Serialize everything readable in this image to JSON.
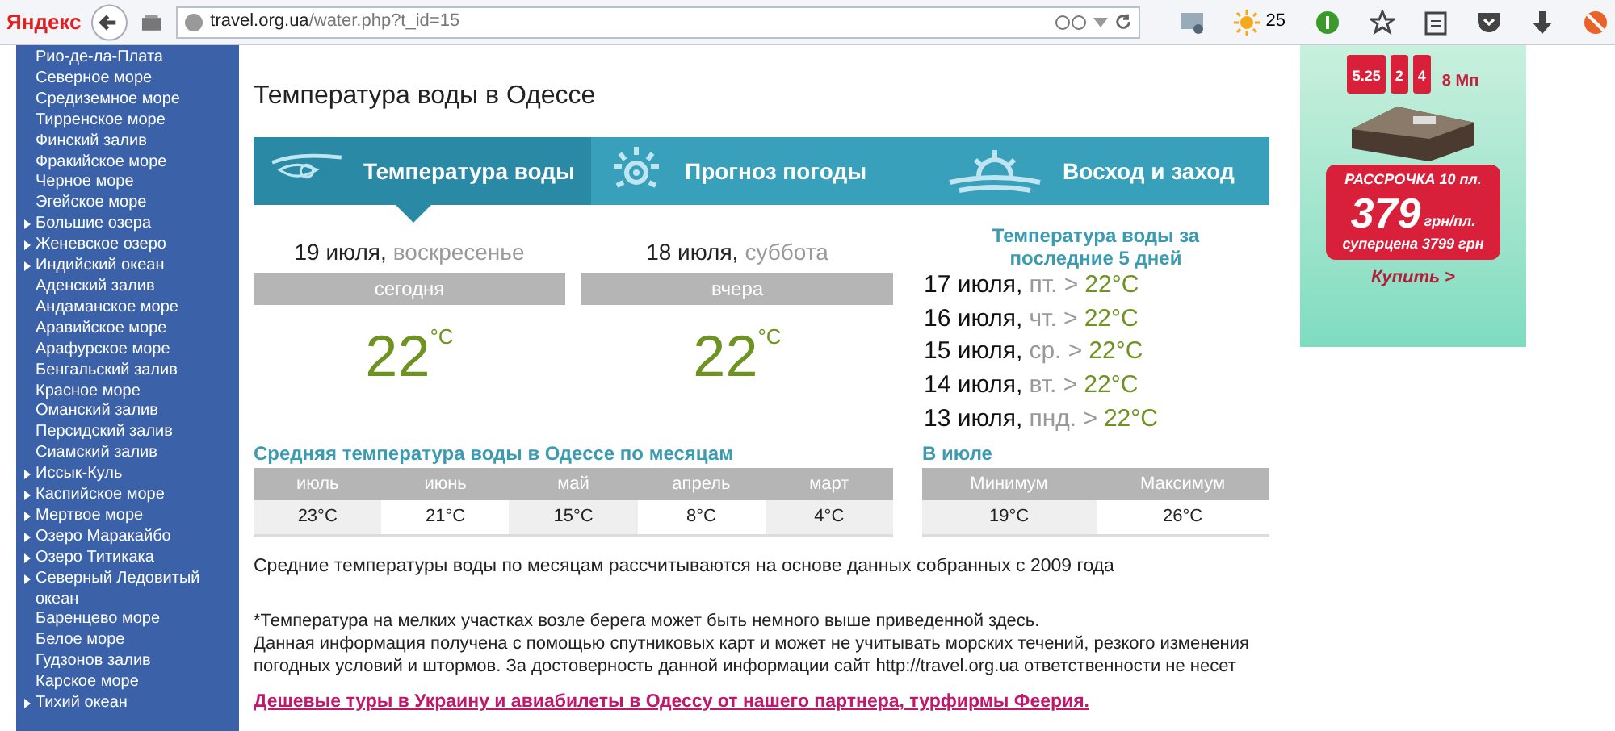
{
  "browser": {
    "logo": "Яндекс",
    "url_host": "travel.org.ua",
    "url_path": "/water.php?t_id=15",
    "weather": "25"
  },
  "sidebar": {
    "items": [
      {
        "label": "Рио-де-ла-Плата",
        "expandable": false
      },
      {
        "label": "Северное море",
        "expandable": false
      },
      {
        "label": "Средиземное море",
        "expandable": false
      },
      {
        "label": "Тирренское море",
        "expandable": false
      },
      {
        "label": "Финский залив",
        "expandable": false
      },
      {
        "label": "Фракийское море",
        "expandable": false
      },
      {
        "label": "Черное море",
        "expandable": false
      },
      {
        "label": "Эгейское море",
        "expandable": false
      },
      {
        "label": "Большие озера",
        "expandable": true
      },
      {
        "label": "Женевское озеро",
        "expandable": true
      },
      {
        "label": "Индийский океан",
        "expandable": true
      },
      {
        "label": "Аденский залив",
        "expandable": false
      },
      {
        "label": "Андаманское море",
        "expandable": false
      },
      {
        "label": "Аравийское море",
        "expandable": false
      },
      {
        "label": "Арафурское море",
        "expandable": false
      },
      {
        "label": "Бенгальский залив",
        "expandable": false
      },
      {
        "label": "Красное море",
        "expandable": false
      },
      {
        "label": "Оманский залив",
        "expandable": false
      },
      {
        "label": "Персидский залив",
        "expandable": false
      },
      {
        "label": "Сиамский залив",
        "expandable": false
      },
      {
        "label": "Иссык-Куль",
        "expandable": true
      },
      {
        "label": "Каспийское море",
        "expandable": true
      },
      {
        "label": "Мертвое море",
        "expandable": true
      },
      {
        "label": "Озеро Маракайбо",
        "expandable": true
      },
      {
        "label": "Озеро Титикака",
        "expandable": true
      },
      {
        "label": "Северный Ледовитый океан",
        "expandable": true
      },
      {
        "label": "Баренцево море",
        "expandable": false
      },
      {
        "label": "Белое море",
        "expandable": false
      },
      {
        "label": "Гудзонов залив",
        "expandable": false
      },
      {
        "label": "Карское море",
        "expandable": false
      },
      {
        "label": "Тихий океан",
        "expandable": true
      }
    ]
  },
  "title": "Температура воды в Одессе",
  "tabs": [
    {
      "label": "Температура воды",
      "kind": "water",
      "selected": true
    },
    {
      "label": "Прогноз погоды",
      "kind": "sun",
      "selected": false
    },
    {
      "label": "Восход и заход",
      "kind": "sunrise",
      "selected": false
    }
  ],
  "days": [
    {
      "date": "19 июля,",
      "weekday": "воскресенье",
      "caption": "сегодня",
      "temp": "22",
      "unit": "°C"
    },
    {
      "date": "18 июля,",
      "weekday": "суббота",
      "caption": "вчера",
      "temp": "22",
      "unit": "°C"
    }
  ],
  "last_days": {
    "title": "Температура воды за последние 5 дней",
    "rows": [
      {
        "date": "17 июля,",
        "weekday": "пт. >",
        "temp": "22°C"
      },
      {
        "date": "16 июля,",
        "weekday": "чт. >",
        "temp": "22°C"
      },
      {
        "date": "15 июля,",
        "weekday": "ср. >",
        "temp": "22°C"
      },
      {
        "date": "14 июля,",
        "weekday": "вт. >",
        "temp": "22°C"
      },
      {
        "date": "13 июля,",
        "weekday": "пнд. >",
        "temp": "22°C"
      }
    ]
  },
  "monthly": {
    "title": "Средняя температура воды в Одессе по месяцам",
    "columns": [
      "июль",
      "июнь",
      "май",
      "апрель",
      "март"
    ],
    "values": [
      "23°C",
      "21°C",
      "15°C",
      "8°C",
      "4°C"
    ]
  },
  "july": {
    "title": "В июле",
    "columns": [
      "Минимум",
      "Максимум"
    ],
    "values": [
      "19°C",
      "26°C"
    ]
  },
  "note": "Средние температуры воды по месяцам рассчитываются на основе данных собранных с 2009 года",
  "disclaimer": [
    "*Температура на мелких участках возле берега может быть немного выше приведенной здесь.",
    "Данная информация получена с помощью спутниковых карт и может не учитывать морских течений, резкого изменения погодных условий и штормов. За достоверность данной информации сайт http://travel.org.ua ответственности не несет"
  ],
  "partner_link": "Дешевые туры в Украину и авиабилеты в Одессу от нашего партнера, турфирмы Феерия.",
  "ad": {
    "badges": [
      "5.25",
      "2",
      "4",
      "8 Мп"
    ],
    "installment": "РАССРОЧКА 10 пл.",
    "price": "379",
    "price_unit": "грн/пл.",
    "super_price": "суперцена 3799 грн",
    "buy": "Купить >"
  }
}
